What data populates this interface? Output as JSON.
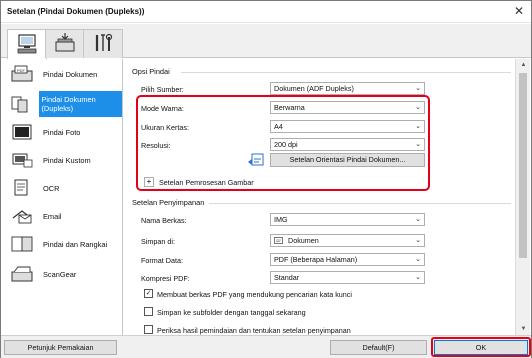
{
  "window": {
    "title": "Setelan (Pindai Dokumen (Dupleks))",
    "close_glyph": "✕"
  },
  "tabs": [
    {
      "icon": "scan-from-computer-icon",
      "active": true
    },
    {
      "icon": "scan-from-panel-icon",
      "active": false
    },
    {
      "icon": "general-settings-icon",
      "active": false
    }
  ],
  "sidebar": {
    "items": [
      {
        "label": "Pindai Dokumen",
        "icon": "document-scan-icon"
      },
      {
        "label": "Pindai Dokumen (Dupleks)",
        "icon": "duplex-scan-icon",
        "active": true
      },
      {
        "label": "Pindai Foto",
        "icon": "photo-scan-icon"
      },
      {
        "label": "Pindai Kustom",
        "icon": "custom-scan-icon"
      },
      {
        "label": "OCR",
        "icon": "ocr-icon"
      },
      {
        "label": "Email",
        "icon": "email-icon"
      },
      {
        "label": "Pindai dan Rangkai",
        "icon": "scan-and-stitch-icon"
      },
      {
        "label": "ScanGear",
        "icon": "scangear-icon"
      }
    ]
  },
  "scan_options": {
    "title": "Opsi Pindai",
    "source_label": "Pilih Sumber:",
    "source_value": "Dokumen (ADF Dupleks)",
    "color_mode_label": "Mode Warna:",
    "color_mode_value": "Berwarna",
    "paper_size_label": "Ukuran Kertas:",
    "paper_size_value": "A4",
    "resolution_label": "Resolusi:",
    "resolution_value": "200 dpi",
    "orientation_button": "Setelan Orientasi Pindai Dokumen...",
    "image_processing_toggle": "+",
    "image_processing_label": "Setelan Pemrosesan Gambar"
  },
  "save_settings": {
    "title": "Setelan Penyimpanan",
    "file_name_label": "Nama Berkas:",
    "file_name_value": "IMG",
    "save_in_label": "Simpan di:",
    "save_in_value": "Dokumen",
    "data_format_label": "Format Data:",
    "data_format_value": "PDF (Beberapa Halaman)",
    "pdf_compression_label": "Kompresi PDF:",
    "pdf_compression_value": "Standar",
    "checkboxes": [
      {
        "label": "Membuat berkas PDF yang mendukung pencarian kata kunci",
        "checked": true
      },
      {
        "label": "Simpan ke subfolder dengan tanggal sekarang",
        "checked": false
      },
      {
        "label": "Periksa hasil pemindaian dan tentukan setelan penyimpanan",
        "checked": false
      }
    ]
  },
  "footer": {
    "instructions_button": "Petunjuk Pemakaian",
    "defaults_button": "Default(F)",
    "ok_button": "OK"
  },
  "colors": {
    "accent": "#1e8fe8",
    "highlight": "#e2001a"
  }
}
